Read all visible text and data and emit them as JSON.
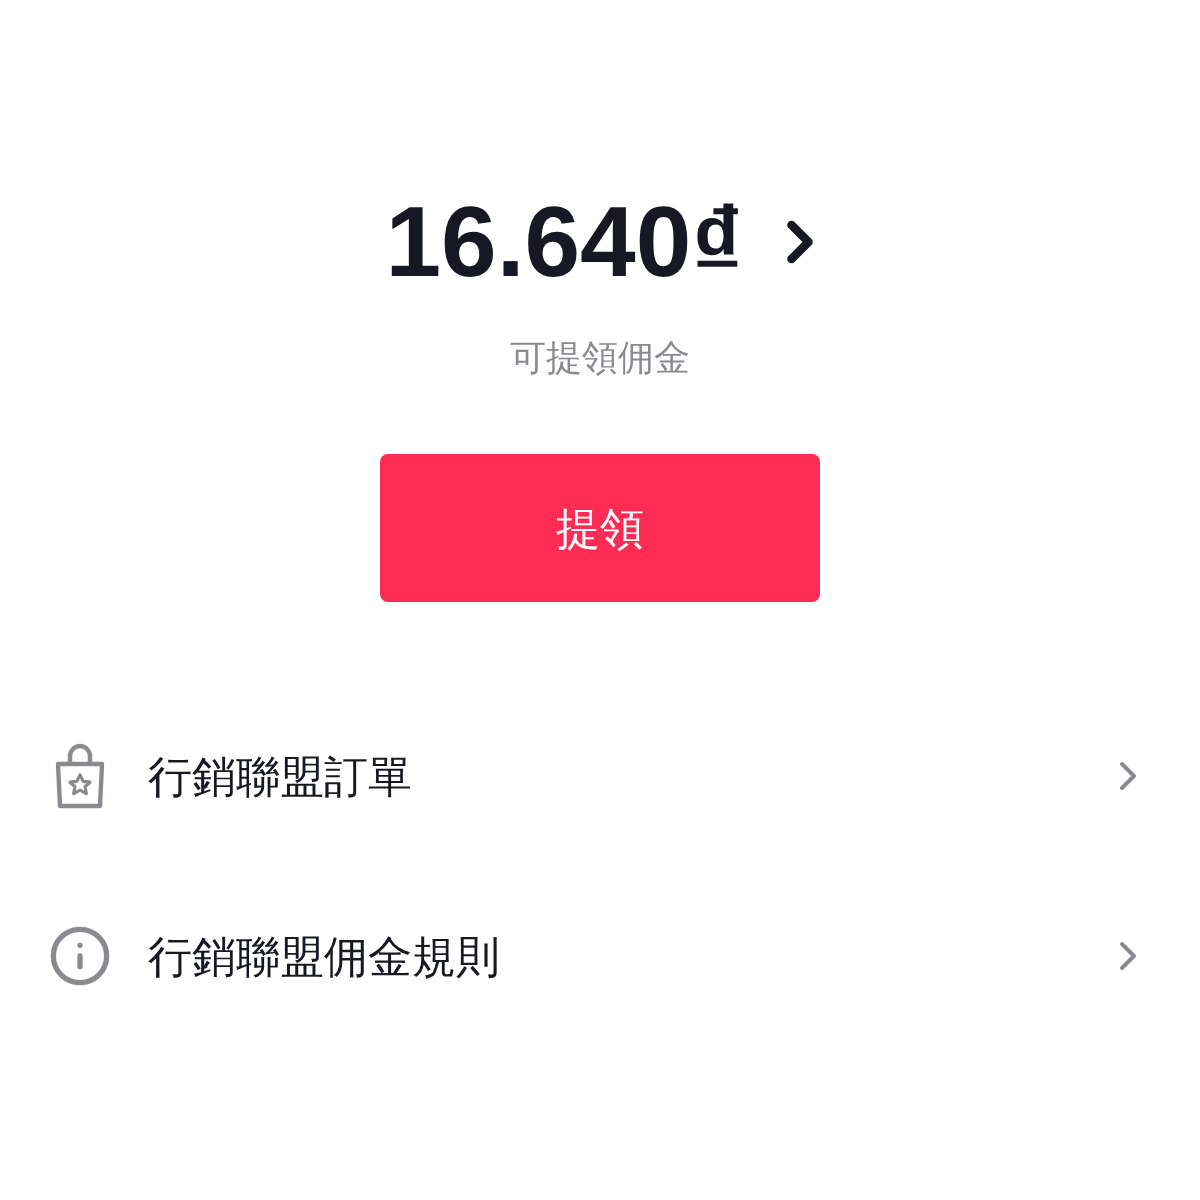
{
  "balance": {
    "amount": "16.640₫",
    "caption": "可提領佣金"
  },
  "withdraw_button": {
    "label": "提領"
  },
  "menu": [
    {
      "kind": "orders",
      "label": "行銷聯盟訂單"
    },
    {
      "kind": "info",
      "label": "行銷聯盟佣金規則"
    }
  ]
}
